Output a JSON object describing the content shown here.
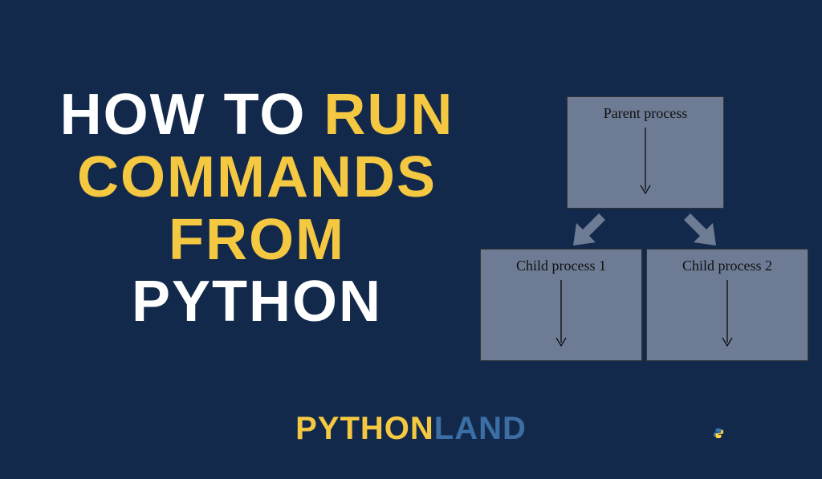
{
  "headline": {
    "line1_a": "HOW TO ",
    "line1_b": "RUN",
    "line2": "COMMANDS",
    "line3": "FROM",
    "line4": "PYTHON"
  },
  "diagram": {
    "parent_label": "Parent process",
    "child1_label": "Child process 1",
    "child2_label": "Child process 2"
  },
  "footer": {
    "word1": "PYTHON ",
    "word2": "LAND"
  },
  "colors": {
    "background": "#13294b",
    "headline_white": "#ffffff",
    "headline_yellow": "#f5c842",
    "box_fill": "#6d7b94",
    "footer_blue": "#3b6ea5"
  }
}
